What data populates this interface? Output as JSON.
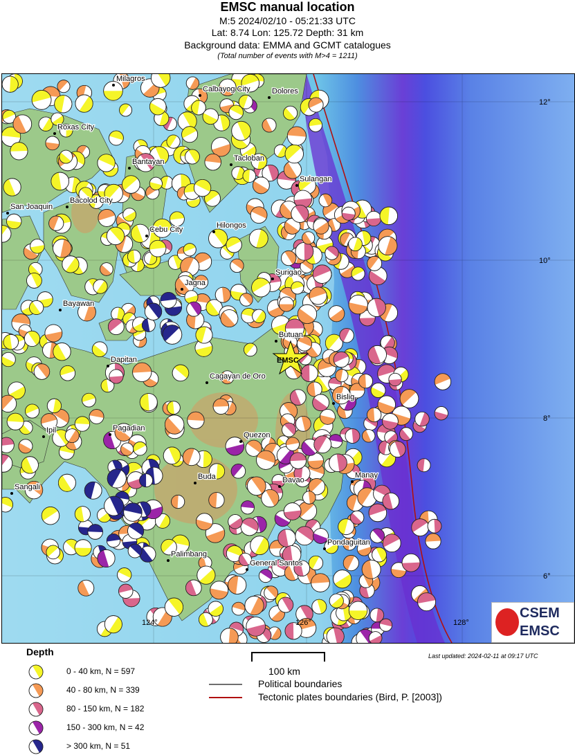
{
  "header": {
    "title": "EMSC manual location",
    "line1": "M:5 2024/02/10 - 05:21:33 UTC",
    "line2": "Lat: 8.74 Lon: 125.72 Depth: 31 km",
    "line3": "Background data: EMMA and GCMT catalogues",
    "line4": "(Total number of events with M>4 = 1211)"
  },
  "map": {
    "places": [
      "Milagros",
      "Calbayog City",
      "Dolores",
      "Roxas City",
      "Bantayan",
      "Tacloban",
      "Sulangan",
      "San Joaquin",
      "Bacolod City",
      "Cebu City",
      "Hilongos",
      "Surigao",
      "Jagna",
      "Bayawan",
      "Butuan",
      "Dapitan",
      "Cagayan de Oro",
      "Bislig",
      "Ipil",
      "Pagadian",
      "Quezon",
      "Sangali",
      "Buda",
      "Davao",
      "Manay",
      "Pondaguitan",
      "Palimbang",
      "General Santos"
    ],
    "epicenter_label": "EMSC",
    "lat_ticks": [
      "12°",
      "10°",
      "8°",
      "6°"
    ],
    "lon_ticks": [
      "124°",
      "126°",
      "128°"
    ]
  },
  "logo": {
    "line1": "CSEM",
    "line2": "EMSC"
  },
  "legend": {
    "title": "Depth",
    "items": [
      {
        "label": "0 - 40 km, N = 597",
        "color": "#f5f528"
      },
      {
        "label": "40 - 80 km, N = 339",
        "color": "#f59a55"
      },
      {
        "label": "80 - 150 km, N = 182",
        "color": "#d9668c"
      },
      {
        "label": "150 - 300 km, N = 42",
        "color": "#9b25a8"
      },
      {
        "label": "> 300 km, N = 51",
        "color": "#26268c"
      }
    ],
    "scale": "100 km",
    "boundaries": [
      {
        "label": "Political boundaries",
        "color": "#6e6e6e"
      },
      {
        "label": "Tectonic plates boundaries (Bird, P. [2003])",
        "color": "#b01010"
      }
    ],
    "updated": "Last updated: 2024-02-11 at 09:17 UTC"
  }
}
